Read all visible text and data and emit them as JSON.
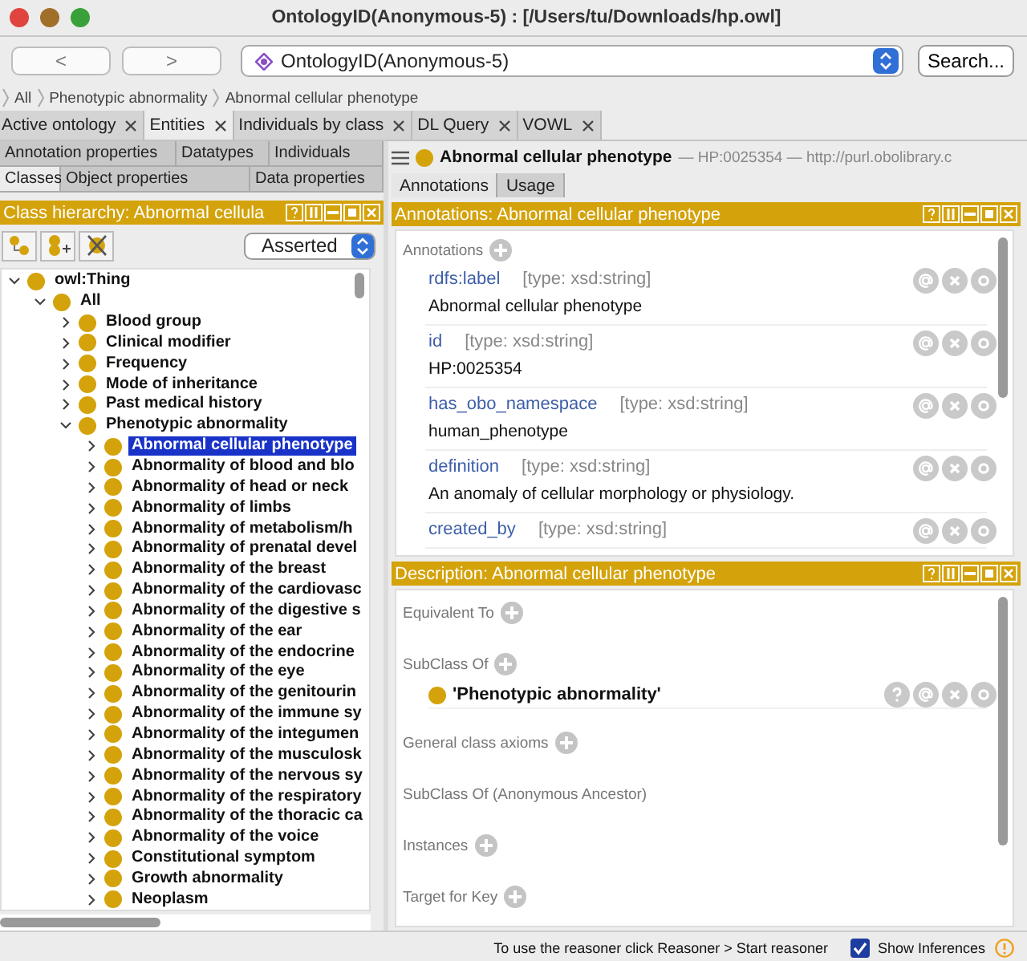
{
  "window": {
    "title": "OntologyID(Anonymous-5) : [/Users/tu/Downloads/hp.owl]"
  },
  "toolbar": {
    "back": "<",
    "forward": ">",
    "ontology": "OntologyID(Anonymous-5)",
    "search": "Search..."
  },
  "breadcrumb": [
    "All",
    "Phenotypic abnormality",
    "Abnormal cellular phenotype"
  ],
  "tabs": [
    {
      "label": "Active ontology",
      "selected": false
    },
    {
      "label": "Entities",
      "selected": true
    },
    {
      "label": "Individuals by class",
      "selected": false
    },
    {
      "label": "DL Query",
      "selected": false
    },
    {
      "label": "VOWL",
      "selected": false
    }
  ],
  "left_panel": {
    "tab_rows": [
      [
        {
          "label": "Annotation properties",
          "selected": false
        },
        {
          "label": "Datatypes",
          "selected": false
        },
        {
          "label": "Individuals",
          "selected": false
        }
      ],
      [
        {
          "label": "Classes",
          "selected": true
        },
        {
          "label": "Object properties",
          "selected": false
        },
        {
          "label": "Data properties",
          "selected": false
        }
      ]
    ],
    "header": "Class hierarchy: Abnormal cellula",
    "view_select": "Asserted",
    "tree": [
      {
        "label": "owl:Thing",
        "expanded": true,
        "selected": false,
        "children": [
          {
            "label": "All",
            "expanded": true,
            "selected": false,
            "children": [
              {
                "label": "Blood group",
                "expanded": false,
                "selected": false
              },
              {
                "label": "Clinical modifier",
                "expanded": false,
                "selected": false
              },
              {
                "label": "Frequency",
                "expanded": false,
                "selected": false
              },
              {
                "label": "Mode of inheritance",
                "expanded": false,
                "selected": false
              },
              {
                "label": "Past medical history",
                "expanded": false,
                "selected": false
              },
              {
                "label": "Phenotypic abnormality",
                "expanded": true,
                "selected": false,
                "children": [
                  {
                    "label": "Abnormal cellular phenotype",
                    "expanded": false,
                    "selected": true
                  },
                  {
                    "label": "Abnormality of blood and blo",
                    "expanded": false,
                    "selected": false
                  },
                  {
                    "label": "Abnormality of head or neck",
                    "expanded": false,
                    "selected": false
                  },
                  {
                    "label": "Abnormality of limbs",
                    "expanded": false,
                    "selected": false
                  },
                  {
                    "label": "Abnormality of metabolism/h",
                    "expanded": false,
                    "selected": false
                  },
                  {
                    "label": "Abnormality of prenatal devel",
                    "expanded": false,
                    "selected": false
                  },
                  {
                    "label": "Abnormality of the breast",
                    "expanded": false,
                    "selected": false
                  },
                  {
                    "label": "Abnormality of the cardiovasc",
                    "expanded": false,
                    "selected": false
                  },
                  {
                    "label": "Abnormality of the digestive s",
                    "expanded": false,
                    "selected": false
                  },
                  {
                    "label": "Abnormality of the ear",
                    "expanded": false,
                    "selected": false
                  },
                  {
                    "label": "Abnormality of the endocrine",
                    "expanded": false,
                    "selected": false
                  },
                  {
                    "label": "Abnormality of the eye",
                    "expanded": false,
                    "selected": false
                  },
                  {
                    "label": "Abnormality of the genitourin",
                    "expanded": false,
                    "selected": false
                  },
                  {
                    "label": "Abnormality of the immune sy",
                    "expanded": false,
                    "selected": false
                  },
                  {
                    "label": "Abnormality of the integumen",
                    "expanded": false,
                    "selected": false
                  },
                  {
                    "label": "Abnormality of the musculosk",
                    "expanded": false,
                    "selected": false
                  },
                  {
                    "label": "Abnormality of the nervous sy",
                    "expanded": false,
                    "selected": false
                  },
                  {
                    "label": "Abnormality of the respiratory",
                    "expanded": false,
                    "selected": false
                  },
                  {
                    "label": "Abnormality of the thoracic ca",
                    "expanded": false,
                    "selected": false
                  },
                  {
                    "label": "Abnormality of the voice",
                    "expanded": false,
                    "selected": false
                  },
                  {
                    "label": "Constitutional symptom",
                    "expanded": false,
                    "selected": false
                  },
                  {
                    "label": "Growth abnormality",
                    "expanded": false,
                    "selected": false
                  },
                  {
                    "label": "Neoplasm",
                    "expanded": false,
                    "selected": false
                  }
                ]
              }
            ]
          }
        ]
      }
    ]
  },
  "right_panel": {
    "entity": {
      "name": "Abnormal cellular phenotype",
      "details": "— HP:0025354 — http://purl.obolibrary.c"
    },
    "tabs": [
      {
        "label": "Annotations",
        "selected": true
      },
      {
        "label": "Usage",
        "selected": false
      }
    ],
    "annotations": {
      "header": "Annotations: Abnormal cellular phenotype",
      "section_label": "Annotations",
      "items": [
        {
          "property": "rdfs:label",
          "type": "[type: xsd:string]",
          "value": "Abnormal cellular phenotype"
        },
        {
          "property": "id",
          "type": "[type: xsd:string]",
          "value": "HP:0025354"
        },
        {
          "property": "has_obo_namespace",
          "type": "[type: xsd:string]",
          "value": "human_phenotype"
        },
        {
          "property": "definition",
          "type": "[type: xsd:string]",
          "value": "An anomaly of cellular morphology or physiology."
        },
        {
          "property": "created_by",
          "type": "[type: xsd:string]"
        }
      ]
    },
    "description": {
      "header": "Description: Abnormal cellular phenotype",
      "sections": [
        {
          "label": "Equivalent To",
          "addable": true
        },
        {
          "label": "SubClass Of",
          "addable": true,
          "items": [
            "'Phenotypic abnormality'"
          ]
        },
        {
          "label": "General class axioms",
          "addable": true
        },
        {
          "label": "SubClass Of (Anonymous Ancestor)",
          "addable": false
        },
        {
          "label": "Instances",
          "addable": true
        },
        {
          "label": "Target for Key",
          "addable": true
        }
      ]
    }
  },
  "status_bar": {
    "message": "To use the reasoner click Reasoner > Start reasoner",
    "show_inferences": {
      "label": "Show Inferences",
      "checked": true
    }
  }
}
